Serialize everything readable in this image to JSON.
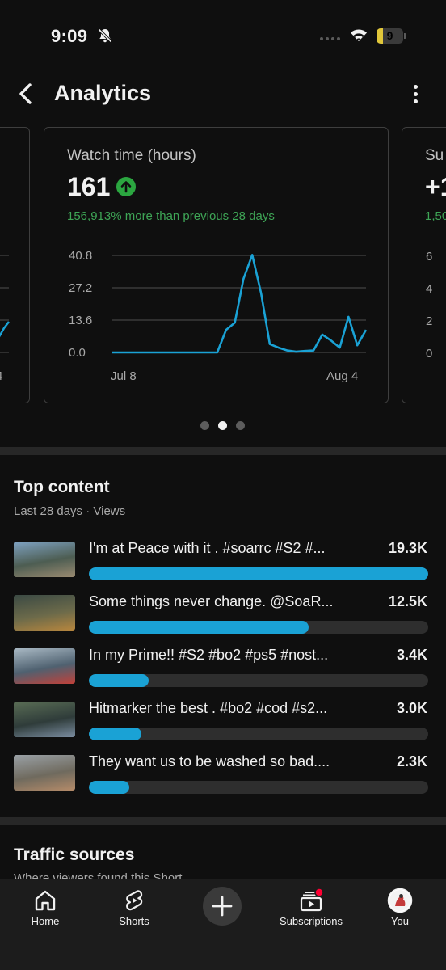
{
  "status_bar": {
    "time": "9:09",
    "battery": "9",
    "battery_level": 0.25,
    "bell_icon": "bell-off-icon",
    "wifi_icon": "wifi-icon"
  },
  "header": {
    "title": "Analytics",
    "back_icon": "chevron-left-icon",
    "more_icon": "more-vertical-icon"
  },
  "cards": {
    "left": {
      "ticks": [
        "4"
      ]
    },
    "main": {
      "label": "Watch time (hours)",
      "value": "161",
      "trend_icon": "arrow-up-icon",
      "change": "156,913% more than previous 28 days"
    },
    "right": {
      "label": "Su",
      "value": "+1",
      "change": "1,50",
      "ticks": [
        "6",
        "4",
        "2",
        "0"
      ]
    }
  },
  "chart_data": {
    "type": "line",
    "title": "Watch time (hours)",
    "xlabel": "",
    "ylabel": "",
    "x_tick_labels": [
      "Jul 8",
      "Aug 4"
    ],
    "y_tick_labels": [
      "40.8",
      "27.2",
      "13.6",
      "0.0"
    ],
    "ylim": [
      0,
      40.8
    ],
    "grid": true,
    "line_color": "#1aa2d5",
    "x": [
      "Jul 8",
      "Jul 9",
      "Jul 10",
      "Jul 11",
      "Jul 12",
      "Jul 13",
      "Jul 14",
      "Jul 15",
      "Jul 16",
      "Jul 17",
      "Jul 18",
      "Jul 19",
      "Jul 20",
      "Jul 21",
      "Jul 22",
      "Jul 23",
      "Jul 24",
      "Jul 25",
      "Jul 26",
      "Jul 27",
      "Jul 28",
      "Jul 29",
      "Jul 30",
      "Jul 31",
      "Aug 1",
      "Aug 2",
      "Aug 3",
      "Aug 4"
    ],
    "values": [
      0,
      0,
      0,
      0,
      0,
      0,
      0,
      0,
      0,
      0,
      0,
      0,
      0,
      9.5,
      12.5,
      31,
      41,
      25,
      3.5,
      2,
      0.8,
      0.3,
      0.6,
      0.8,
      7.5,
      5,
      2,
      15,
      3,
      9.5
    ]
  },
  "carousel": {
    "count": 3,
    "active": 1
  },
  "top_content": {
    "title": "Top content",
    "subtitle": "Last 28 days · Views",
    "max_views": 19.3,
    "items": [
      {
        "title": "I'm at Peace with it . #soarrc #S2 #...",
        "views": "19.3K",
        "value": 19.3,
        "thumb_colors": [
          "#7fa3c4",
          "#4d5d52",
          "#9a8a70"
        ]
      },
      {
        "title": "Some things never change. @SoaR...",
        "views": "12.5K",
        "value": 12.5,
        "thumb_colors": [
          "#3b4a44",
          "#6c6a4a",
          "#b7863e"
        ]
      },
      {
        "title": "In my Prime!! #S2 #bo2 #ps5 #nost...",
        "views": "3.4K",
        "value": 3.4,
        "thumb_colors": [
          "#a9b9c4",
          "#4f6170",
          "#c0413a"
        ]
      },
      {
        "title": "Hitmarker the best . #bo2 #cod #s2...",
        "views": "3.0K",
        "value": 3.0,
        "thumb_colors": [
          "#5a6d55",
          "#2f3c3a",
          "#7b8da0"
        ]
      },
      {
        "title": "They want us to be washed so bad....",
        "views": "2.3K",
        "value": 2.3,
        "thumb_colors": [
          "#9aa1a6",
          "#6f6a5e",
          "#b58b69"
        ]
      }
    ]
  },
  "traffic": {
    "title": "Traffic sources",
    "subtitle": "Where viewers found this Short"
  },
  "nav": {
    "items": [
      {
        "label": "Home",
        "icon": "home-icon"
      },
      {
        "label": "Shorts",
        "icon": "shorts-icon"
      },
      {
        "label": "",
        "icon": "plus-icon"
      },
      {
        "label": "Subscriptions",
        "icon": "subscriptions-icon"
      },
      {
        "label": "You",
        "icon": "avatar-icon"
      }
    ],
    "notification_color": "#ff0033"
  }
}
